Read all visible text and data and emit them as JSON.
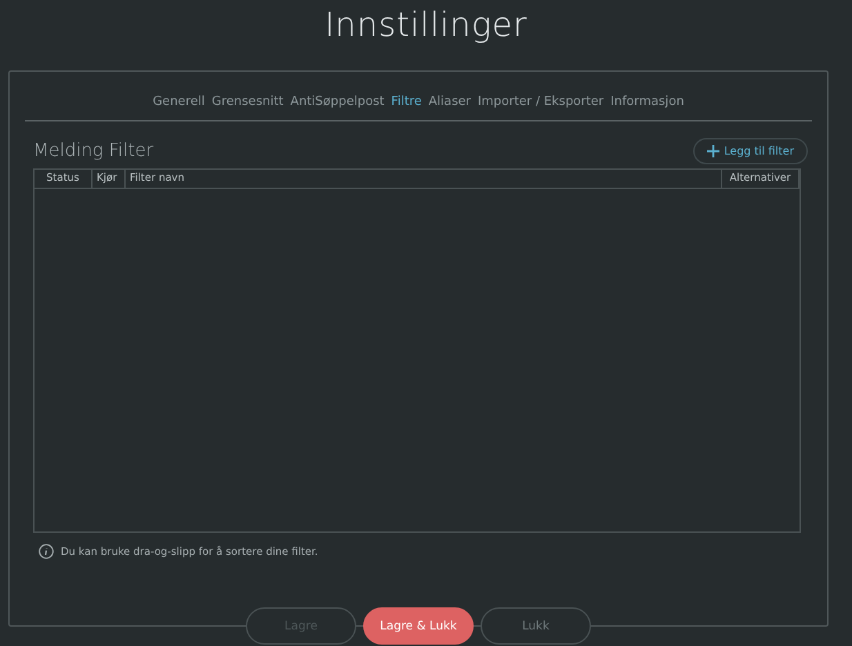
{
  "title": "Innstillinger",
  "tabs": [
    {
      "label": "Generell",
      "selected": false
    },
    {
      "label": "Grensesnitt",
      "selected": false
    },
    {
      "label": "AntiSøppelpost",
      "selected": false
    },
    {
      "label": "Filtre",
      "selected": true
    },
    {
      "label": "Aliaser",
      "selected": false
    },
    {
      "label": "Importer / Eksporter",
      "selected": false
    },
    {
      "label": "Informasjon",
      "selected": false
    }
  ],
  "section_title": "Melding Filter",
  "add_button": "Legg til filter",
  "table": {
    "columns": [
      "Status",
      "Kjør",
      "Filter navn",
      "Alternativer"
    ]
  },
  "hint": "Du kan bruke dra-og-slipp for å sortere dine filter.",
  "buttons": [
    {
      "label": "Lagre",
      "kind": "plain",
      "disabled": true
    },
    {
      "label": "Lagre & Lukk",
      "kind": "primary",
      "disabled": false
    },
    {
      "label": "Lukk",
      "kind": "plain",
      "disabled": false
    }
  ]
}
